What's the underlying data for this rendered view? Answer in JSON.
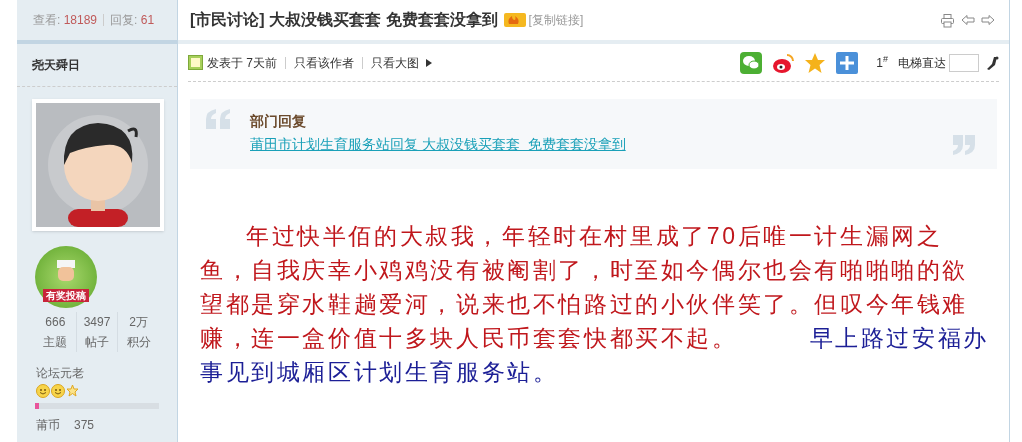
{
  "thread_stats": {
    "views_label": "查看:",
    "views": "18189",
    "replies_label": "回复:",
    "replies": "61"
  },
  "thread_title": {
    "category": "[市民讨论]",
    "title": "大叔没钱买套套 免费套套没拿到",
    "copy_link": "[复制链接]"
  },
  "author": {
    "name": "尧天舜日",
    "badge": "有奖投稿",
    "stats": [
      {
        "value": "666",
        "label": "主题"
      },
      {
        "value": "3497",
        "label": "帖子"
      },
      {
        "value": "2万",
        "label": "积分"
      }
    ],
    "rank": "论坛元老",
    "rank_icons": [
      {
        "kind": "smile"
      },
      {
        "kind": "smile"
      },
      {
        "kind": "star"
      }
    ],
    "progress": {
      "level": 0.03
    },
    "currency_label": "莆币",
    "currency": "375"
  },
  "post_meta": {
    "posted": "发表于 7天前",
    "links": [
      "只看该作者",
      "只看大图"
    ]
  },
  "floor": {
    "number": "1",
    "mark": "#",
    "jump_label": "电梯直达"
  },
  "share_icons": [
    {
      "kind": "wechat"
    },
    {
      "kind": "weibo"
    },
    {
      "kind": "qzone"
    },
    {
      "kind": "plus"
    }
  ],
  "quote": {
    "heading": "部门回复",
    "link": "莆田市计划生育服务站回复 大叔没钱买套套  免费套套没拿到"
  },
  "body": [
    {
      "text": "年过快半佰的大叔我，年轻时在村里成了70后唯一计生漏网之鱼，自我庆幸小鸡鸡没有被阉割了，时至如今偶尔也会有啪啪啪的欲望都是穿水鞋趟爱河，说来也不怕路过的小伙伴笑了。但叹今年钱难赚，连一盒价值十多块人民币套套快都买不起。",
      "color": "#c0171c"
    },
    {
      "text": "        早上路过安福办事见到城厢区计划生育服务站。",
      "color": "#1c1f96"
    }
  ]
}
